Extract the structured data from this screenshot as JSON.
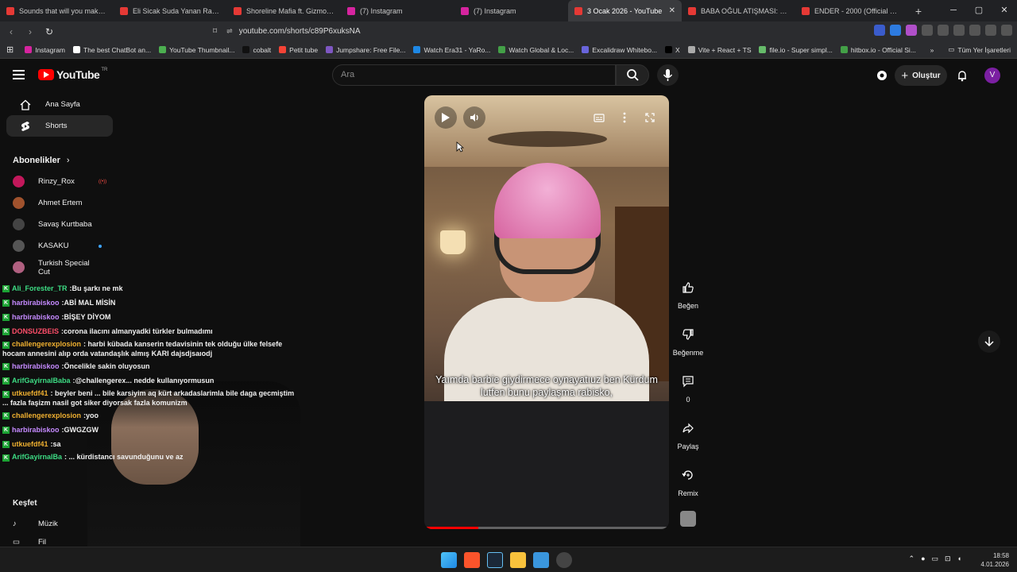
{
  "browser": {
    "tabs": [
      {
        "title": "Sounds that will you make mis",
        "color": "#e53935"
      },
      {
        "title": "Eli Sicak Suda Yanan Rapçi Kız",
        "color": "#e53935"
      },
      {
        "title": "Shoreline Mafia ft. Gizmo - Do",
        "color": "#e53935"
      },
      {
        "title": "(7) Instagram",
        "color": "#d6249f"
      },
      {
        "title": "(7) Instagram",
        "color": "#d6249f"
      },
      {
        "title": "3 Ocak 2026 - YouTube",
        "color": "#e53935",
        "active": true
      },
      {
        "title": "BABA OĞUL ATIŞMASI: Neşet E",
        "color": "#e53935"
      },
      {
        "title": "ENDER - 2000 (Official Music V",
        "color": "#e53935"
      }
    ],
    "url": "youtube.com/shorts/c89P6xuksNA",
    "bookmarks": [
      {
        "label": "Instagram",
        "color": "#d6249f"
      },
      {
        "label": "The best ChatBot an...",
        "color": "#ffffff"
      },
      {
        "label": "YouTube Thumbnail...",
        "color": "#4caf50"
      },
      {
        "label": "cobalt",
        "color": "#111111"
      },
      {
        "label": "Petit tube",
        "color": "#f44336"
      },
      {
        "label": "Jumpshare: Free File...",
        "color": "#7e57c2"
      },
      {
        "label": "Watch Era31 - YaRo...",
        "color": "#1e88e5"
      },
      {
        "label": "Watch Global & Loc...",
        "color": "#43a047"
      },
      {
        "label": "Excalidraw Whitebo...",
        "color": "#6965db"
      },
      {
        "label": "X",
        "color": "#000000"
      },
      {
        "label": "Vite + React + TS",
        "color": "#aaaaaa"
      },
      {
        "label": "file.io - Super simpl...",
        "color": "#66bb6a"
      },
      {
        "label": "hitbox.io - Official Si...",
        "color": "#43a047"
      }
    ],
    "all_bookmarks": "Tüm Yer İşaretleri"
  },
  "youtube": {
    "logo_text": "YouTube",
    "logo_region": "TR",
    "search_placeholder": "Ara",
    "create_label": "Oluştur",
    "avatar_letter": "V",
    "nav": [
      {
        "label": "Ana Sayfa"
      },
      {
        "label": "Shorts",
        "selected": true
      }
    ],
    "subscriptions_title": "Abonelikler",
    "subscriptions": [
      {
        "name": "Rinzy_Rox",
        "color": "#c2185b",
        "indicator": "live"
      },
      {
        "name": "Ahmet Ertem",
        "color": "#a0522d"
      },
      {
        "name": "Savaş Kurtbaba",
        "color": "#444444"
      },
      {
        "name": "KASAKU",
        "color": "#555555",
        "indicator": "dot"
      },
      {
        "name": "Turkish Special Cut",
        "color": "#b06080"
      }
    ],
    "explore_title": "Keşfet",
    "explore_items": [
      {
        "label": "Müzik"
      },
      {
        "label": "Fil"
      }
    ]
  },
  "chat": [
    {
      "user": "Ali_Forester_TR",
      "color": "#3ddc84",
      "msg": "Bu şarkı ne mk"
    },
    {
      "user": "harbirabiskoo",
      "color": "#c58aff",
      "msg": "ABİ MAL MİSİN"
    },
    {
      "user": "harbirabiskoo",
      "color": "#c58aff",
      "msg": "BİŞEY DİYOM"
    },
    {
      "user": "DONSUZBEIS",
      "color": "#ff4e6a",
      "msg": "corona ilacını almanyadki türkler bulmadımı"
    },
    {
      "user": "challengerexplosion",
      "color": "#f0b030",
      "msg": "harbi kübada kanserin tedavisinin tek olduğu ülke felsefe hocam annesini alıp orda vatandaşlık almış KARI dajsdjsaıodj",
      "wrap": true
    },
    {
      "user": "harbirabiskoo",
      "color": "#c58aff",
      "msg": "Öncelikle sakin oluyosun"
    },
    {
      "user": "ArifGayirnalBaba",
      "color": "#3ddc84",
      "msg": "@challengerex... nedde kullanıyormusun"
    },
    {
      "user": "utkuefdf41",
      "color": "#f0b030",
      "msg": "beyler beni ... bile karsiyim aq kürt arkadaslarimla bile daga gecmiştim ... fazla faşizm nasil got siker diyorsak fazla komunizm",
      "wrap": true
    },
    {
      "user": "challengerexplosion",
      "color": "#f0b030",
      "msg": "yoo"
    },
    {
      "user": "harbirabiskoo",
      "color": "#c58aff",
      "msg": "GWGZGW"
    },
    {
      "user": "utkuefdf41",
      "color": "#f0b030",
      "msg": "sa"
    },
    {
      "user": "ArifGayirnalBa",
      "color": "#3ddc84",
      "msg": "... kürdistancı savunduğunu ve az",
      "wrap": true
    }
  ],
  "video": {
    "caption": "Yaımda barbie giydirmece oynayatıuz ben Kürdum lutfen bunu paylaşma rabisko,",
    "progress": 0.22
  },
  "actions": [
    {
      "label": "Beğen",
      "icon": "like-icon"
    },
    {
      "label": "Beğenme",
      "icon": "dislike-icon"
    },
    {
      "label": "0",
      "icon": "comment-icon"
    },
    {
      "label": "Paylaş",
      "icon": "share-icon"
    },
    {
      "label": "Remix",
      "icon": "remix-icon"
    }
  ],
  "taskbar": {
    "time": "18:58",
    "date": "4.01.2026"
  }
}
